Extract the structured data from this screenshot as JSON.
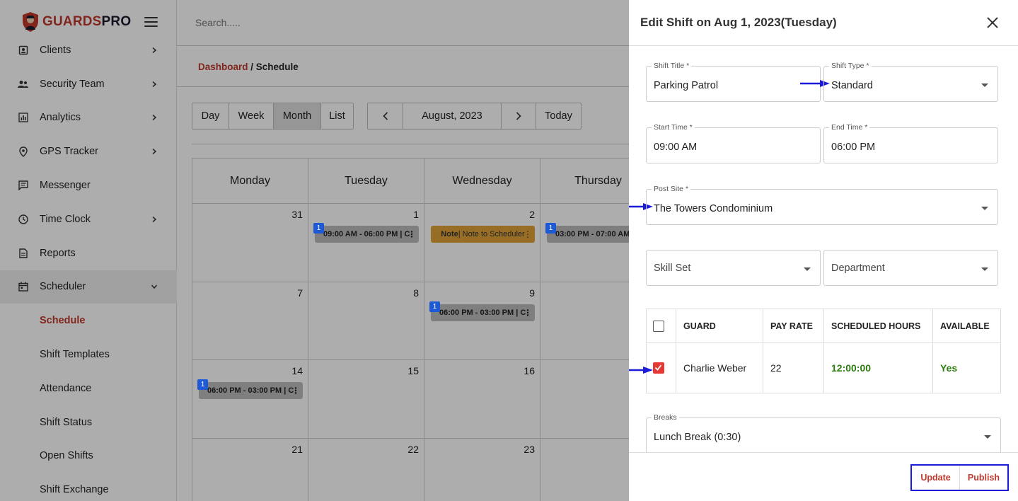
{
  "brand": {
    "name_part1": "GUARDS",
    "name_part2": "PRO"
  },
  "search": {
    "placeholder": "Search....."
  },
  "sidebar": {
    "items": [
      {
        "label": "Clients",
        "icon": "clients-icon",
        "chevron": true
      },
      {
        "label": "Security Team",
        "icon": "team-icon",
        "chevron": true
      },
      {
        "label": "Analytics",
        "icon": "analytics-icon",
        "chevron": true
      },
      {
        "label": "GPS Tracker",
        "icon": "location-pin-icon",
        "chevron": true
      },
      {
        "label": "Messenger",
        "icon": "message-icon",
        "chevron": false
      },
      {
        "label": "Time Clock",
        "icon": "clock-icon",
        "chevron": true
      },
      {
        "label": "Reports",
        "icon": "report-icon",
        "chevron": false
      },
      {
        "label": "Scheduler",
        "icon": "calendar-icon",
        "chevron": true,
        "expanded": true
      }
    ],
    "sub_items": [
      "Schedule",
      "Shift Templates",
      "Attendance",
      "Shift Status",
      "Open Shifts",
      "Shift Exchange"
    ]
  },
  "breadcrumb": {
    "link": "Dashboard",
    "separator": " / ",
    "current": "Schedule"
  },
  "view_buttons": [
    "Day",
    "Week",
    "Month",
    "List"
  ],
  "nav_buttons": {
    "prev": "‹",
    "period": "August, 2023",
    "next": "›",
    "today": "Today"
  },
  "calendar": {
    "days": [
      "Monday",
      "Tuesday",
      "Wednesday",
      "Thursday"
    ],
    "rows": [
      [
        {
          "num": "31"
        },
        {
          "num": "1",
          "event": "09:00 AM - 06:00 PM | C",
          "badge": "1"
        },
        {
          "num": "2",
          "note_label": "Note",
          "note_text": " | Note to Scheduler"
        },
        {
          "num": "",
          "event": "03:00 PM - 07:00 AM",
          "badge": "1"
        }
      ],
      [
        {
          "num": "7"
        },
        {
          "num": "8"
        },
        {
          "num": "9",
          "event": "06:00 PM - 03:00 PM | C",
          "badge": "1"
        },
        {
          "num": ""
        }
      ],
      [
        {
          "num": "14",
          "event": "06:00 PM - 03:00 PM | C",
          "badge": "1"
        },
        {
          "num": "15"
        },
        {
          "num": "16"
        },
        {
          "num": ""
        }
      ],
      [
        {
          "num": "21"
        },
        {
          "num": "22"
        },
        {
          "num": "23"
        },
        {
          "num": ""
        }
      ]
    ]
  },
  "drawer": {
    "title": "Edit Shift on Aug 1, 2023(Tuesday)",
    "shift_title": {
      "label": "Shift Title *",
      "value": "Parking Patrol"
    },
    "shift_type": {
      "label": "Shift Type *",
      "value": "Standard"
    },
    "start_time": {
      "label": "Start Time *",
      "value": "09:00 AM"
    },
    "end_time": {
      "label": "End Time *",
      "value": "06:00 PM"
    },
    "post_site": {
      "label": "Post Site *",
      "value": "The Towers Condominium"
    },
    "skill_set": {
      "placeholder": "Skill Set"
    },
    "department": {
      "placeholder": "Department"
    },
    "table": {
      "headers": [
        "GUARD",
        "PAY RATE",
        "SCHEDULED HOURS",
        "AVAILABLE"
      ],
      "rows": [
        {
          "guard": "Charlie Weber",
          "pay_rate": "22",
          "hours": "12:00:00",
          "available": "Yes",
          "checked": true
        }
      ]
    },
    "breaks": {
      "label": "Breaks",
      "value": "Lunch Break (0:30)"
    },
    "update_label": "Update",
    "publish_label": "Publish"
  },
  "colors": {
    "brand_red": "#c0392b",
    "checkbox_red": "#e53935",
    "annotation_blue": "#1b1bd9",
    "green": "#2e7d0f",
    "note_orange": "#e0a23a",
    "badge_blue": "#1e5ad6"
  }
}
